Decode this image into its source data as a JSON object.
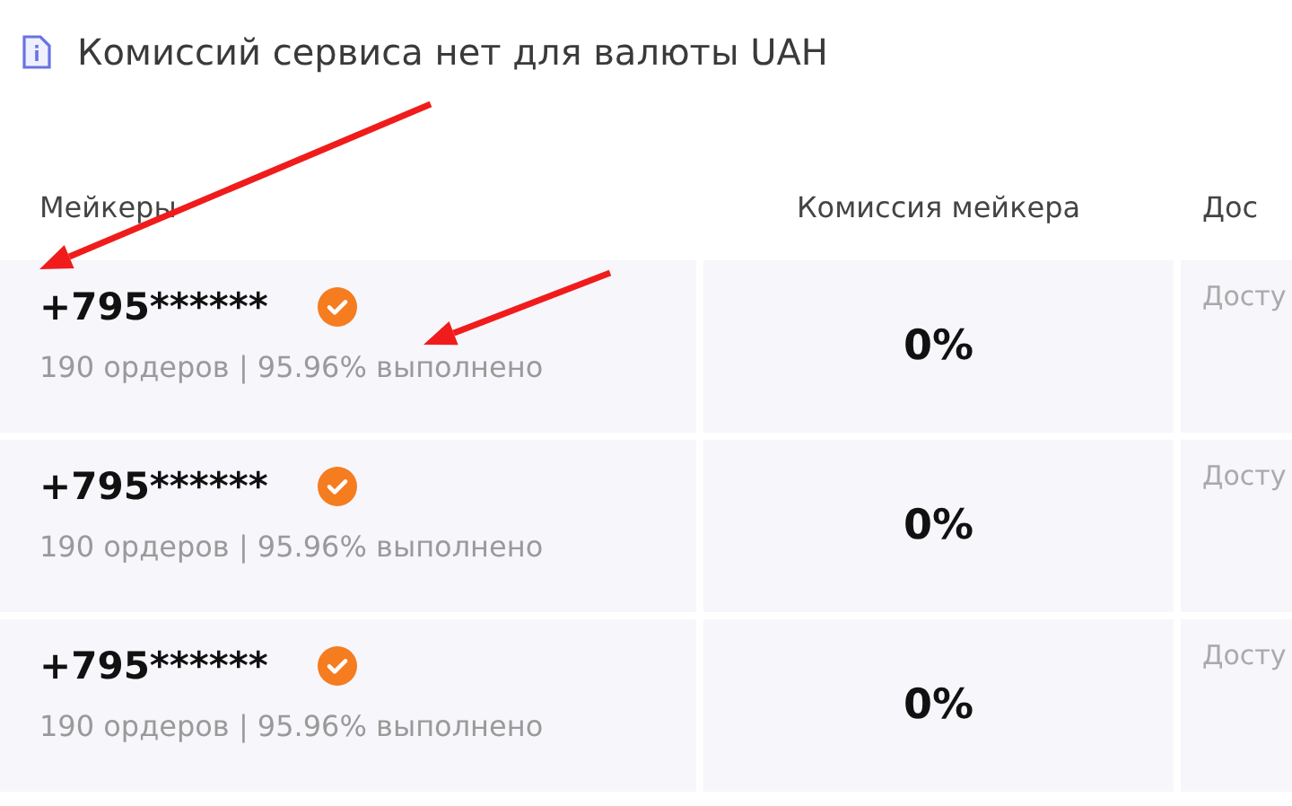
{
  "notice": {
    "text": "Комиссий сервиса нет для валюты UAH"
  },
  "table": {
    "columns": [
      "Мейкеры",
      "Комиссия мейкера",
      "Дос"
    ],
    "rows": [
      {
        "phone": "+795******",
        "verified": true,
        "stats": "190 ордеров | 95.96% выполнено",
        "commission": "0%",
        "column_3": "Досту"
      },
      {
        "phone": "+795******",
        "verified": true,
        "stats": "190 ордеров | 95.96% выполнено",
        "commission": "0%",
        "column_3": "Досту"
      },
      {
        "phone": "+795******",
        "verified": true,
        "stats": "190 ордеров | 95.96% выполнено",
        "commission": "0%",
        "column_3": "Досту"
      }
    ]
  },
  "annotations": [
    {
      "kind": "arrow"
    },
    {
      "kind": "arrow"
    }
  ]
}
